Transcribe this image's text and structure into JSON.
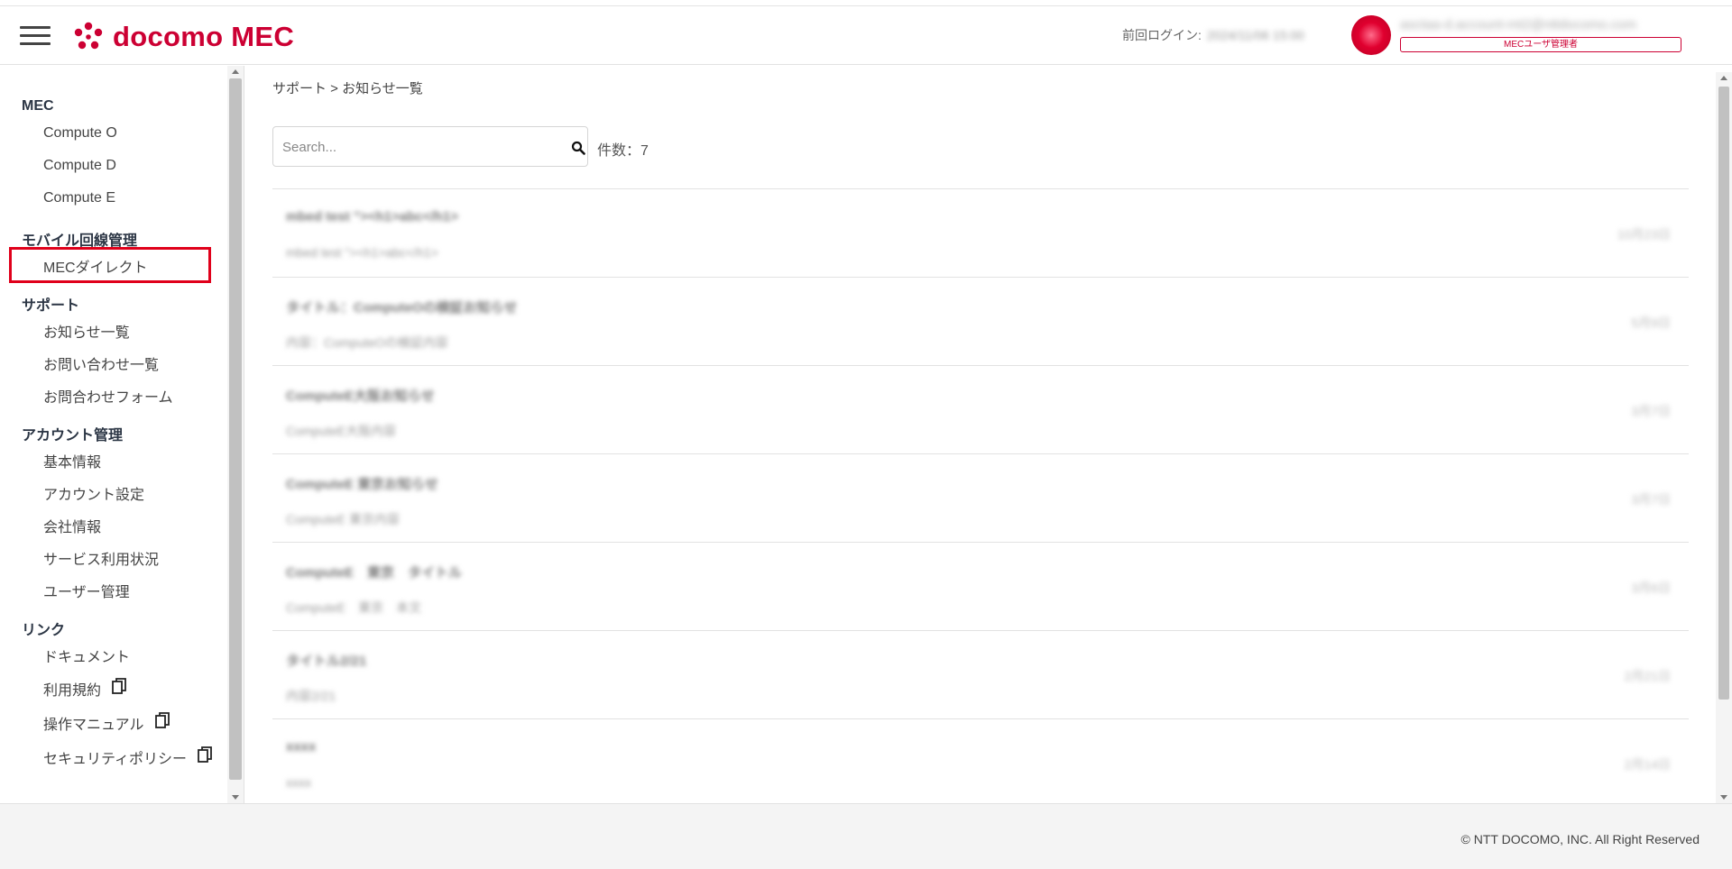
{
  "header": {
    "brand": "docomo MEC",
    "last_login_label": "前回ログイン:",
    "last_login_value": "2024/11/06 15:00",
    "account_email": "asctaa-d.account-mt2@nttdocomo.com",
    "role_badge": "MECユーザ管理者"
  },
  "sidebar": {
    "sections": [
      {
        "title": "MEC",
        "items": [
          "Compute O",
          "Compute D",
          "Compute E"
        ]
      },
      {
        "title": "モバイル回線管理",
        "items": [
          "MECダイレクト"
        ]
      },
      {
        "title": "サポート",
        "items": [
          "お知らせ一覧",
          "お問い合わせ一覧",
          "お問合わせフォーム"
        ]
      },
      {
        "title": "アカウント管理",
        "items": [
          "基本情報",
          "アカウント設定",
          "会社情報",
          "サービス利用状況",
          "ユーザー管理"
        ]
      },
      {
        "title": "リンク",
        "items": [
          "ドキュメント",
          "利用規約",
          "操作マニュアル",
          "セキュリティポリシー"
        ]
      }
    ]
  },
  "main": {
    "breadcrumb": "サポート > お知らせ一覧",
    "search_placeholder": "Search...",
    "count_text": "件数：7",
    "notices": [
      {
        "title": "mbed test \"><h1>abc</h1>",
        "body": "mbed test \"><h1>abc</h1>",
        "date": "10月23日"
      },
      {
        "title": "タイトル：ComputeOの検証お知らせ",
        "body": "内容：ComputeOの検証内容",
        "date": "5月9日"
      },
      {
        "title": "ComputeE大阪お知らせ",
        "body": "ComputeE大阪内容",
        "date": "3月7日"
      },
      {
        "title": "ComputeE 東京お知らせ",
        "body": "ComputeE 東京内容",
        "date": "3月7日"
      },
      {
        "title": "ComputeE　東京　タイトル",
        "body": "ComputeE　東京　本文",
        "date": "3月6日"
      },
      {
        "title": "タイトル2/21",
        "body": "内容2/21",
        "date": "2月21日"
      },
      {
        "title": "xxxx",
        "body": "xxxx",
        "date": "2月14日"
      }
    ]
  },
  "footer": {
    "copyright": "© NTT DOCOMO, INC. All Right Reserved"
  },
  "colors": {
    "brand": "#cc0033",
    "highlight": "#e0001b",
    "section_title": "#2b3544"
  },
  "icons": {
    "menu": "hamburger-icon",
    "search": "search-icon",
    "external": "copy-icon"
  }
}
